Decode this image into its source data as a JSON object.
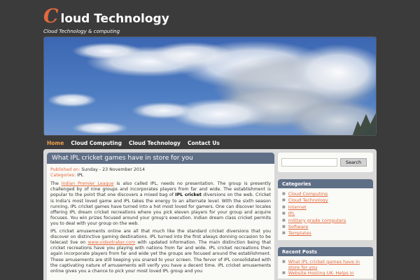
{
  "header": {
    "title_initial": "C",
    "title_rest": "loud Technology",
    "tagline": "Cloud Technology & computing"
  },
  "nav": {
    "items": [
      {
        "label": "Home"
      },
      {
        "label": "Cloud Computing"
      },
      {
        "label": "Cloud Technology"
      },
      {
        "label": "Contact Us"
      }
    ]
  },
  "post": {
    "title": "What IPL cricket games have in store for you",
    "published_label": "Published on:",
    "published_value": "Sunday - 23 November 2014",
    "categories_label": "Categories:",
    "categories_value": "IPL",
    "p1_a": "The ",
    "p1_link": "Indian Premier League",
    "p1_b": " is also called IPL, needs no presentation. The group is presently challenged by of nine groups and incorporates players from far and wide. The establishment is popular to the point that one discovers a mixed bag of ",
    "p1_bold": "IPL cricket",
    "p1_c": " diversions on the web. Cricket is India’s most loved game and IPL takes the energy to an alternate level. With the sixth season running, IPL cricket games have turned into a hot most loved for gamers. One can discover locales offering IPL dream cricket recreations where you pick eleven players for your group and acquire focuses. You win prizes focused around your group's execution. Indian dream class cricket permits you to deal with your group on the web.",
    "p2_a": "IPL cricket amusements online are all that much like the standard cricket diversions that you discover on distinctive gaming destinations. IPL turned into the first always donning occasion to be telecast live on ",
    "p2_link": "www.videotraker.com",
    "p2_b": " with updated information. The main distinction being that cricket recreations have you playing with nations from far and wide. IPL cricket recreations then again incorporate players from far and wide yet the groups are focused around the establishment. These amusements are still keeping you snared to your screen. The fervor of IPL consolidated with the captivating nature of amusements will verify you have a decent time. IPL cricket amusements online gives you a chance to pick your most loved IPL group and you"
  },
  "search": {
    "placeholder": "",
    "button_label": "Search"
  },
  "categories": {
    "title": "Categories",
    "items": [
      {
        "label": "Cloud Computing"
      },
      {
        "label": "Cloud Technology"
      },
      {
        "label": "Internet"
      },
      {
        "label": "IPL"
      },
      {
        "label": "military grade computers"
      },
      {
        "label": "Software"
      },
      {
        "label": "Templates"
      }
    ]
  },
  "recent_posts": {
    "title": "Recent Posts",
    "items": [
      {
        "label": "What IPL cricket games have in store for you"
      },
      {
        "label": "Website Hosting UK- Helps in"
      }
    ]
  },
  "colors": {
    "accent": "#e2693e",
    "header_bar": "#5f6f86",
    "background": "#3b3b3b"
  },
  "icons": {
    "bullet": "square-bullet-icon"
  }
}
